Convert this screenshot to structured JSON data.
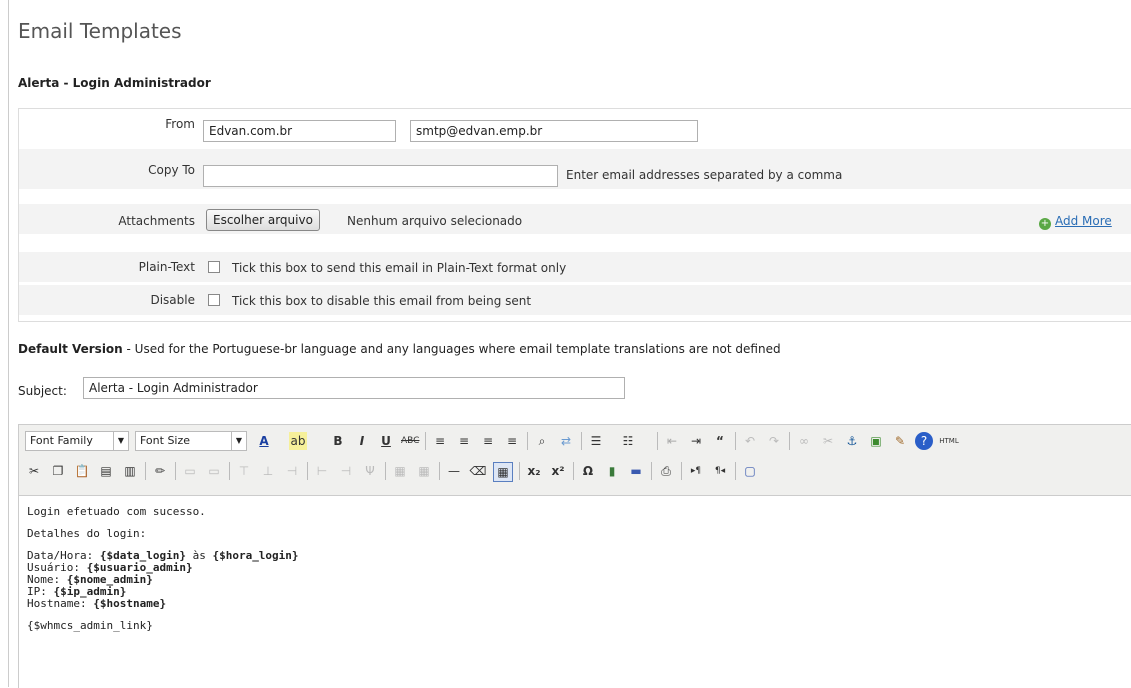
{
  "page": {
    "title": "Email Templates",
    "template_name": "Alerta - Login Administrador"
  },
  "form": {
    "from_label": "From",
    "from_name": "Edvan.com.br",
    "from_email": "smtp@edvan.emp.br",
    "copy_to_label": "Copy To",
    "copy_to_value": "",
    "copy_to_hint": "Enter email addresses separated by a comma",
    "attachments_label": "Attachments",
    "file_button": "Escolher arquivo",
    "file_status": "Nenhum arquivo selecionado",
    "add_more": "Add More",
    "plaintext_label": "Plain-Text",
    "plaintext_hint": "Tick this box to send this email in Plain-Text format only",
    "disable_label": "Disable",
    "disable_hint": "Tick this box to disable this email from being sent"
  },
  "default_version": {
    "heading": "Default Version",
    "description": " - Used for the Portuguese-br language and any languages where email template translations are not defined"
  },
  "subject": {
    "label": "Subject:",
    "value": "Alerta - Login Administrador"
  },
  "editor": {
    "font_family": "Font Family",
    "font_size": "Font Size",
    "html_label": "HTML",
    "body": {
      "line1": "Login efetuado com sucesso.",
      "line2": "Detalhes do login:",
      "datahora_label": "Data/Hora: ",
      "datahora_var1": "{$data_login}",
      "datahora_sep": " às ",
      "datahora_var2": "{$hora_login}",
      "usuario_label": "Usuário: ",
      "usuario_var": "{$usuario_admin}",
      "nome_label": "Nome: ",
      "nome_var": "{$nome_admin}",
      "ip_label": "IP: ",
      "ip_var": "{$ip_admin}",
      "hostname_label": "Hostname: ",
      "hostname_var": "{$hostname}",
      "link": "{$whmcs_admin_link}"
    }
  }
}
